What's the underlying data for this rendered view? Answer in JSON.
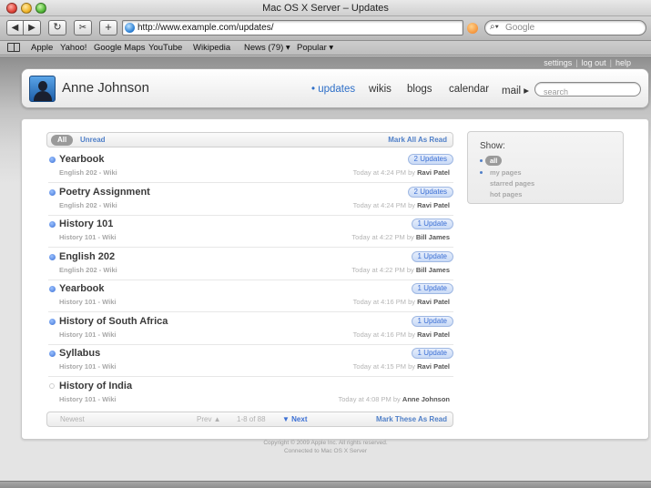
{
  "window": {
    "title": "Mac OS X Server – Updates"
  },
  "browser": {
    "url": "http://www.example.com/updates/",
    "search_placeholder": "Google",
    "bookmarks": [
      "Apple",
      "Yahoo!",
      "Google Maps",
      "YouTube",
      "Wikipedia",
      "News (79) ▾",
      "Popular ▾"
    ]
  },
  "utility_links": {
    "settings": "settings",
    "logout": "log out",
    "help": "help",
    "separator": "|"
  },
  "header": {
    "user_name": "Anne Johnson",
    "nav": {
      "updates": "• updates",
      "wikis": "wikis",
      "blogs": "blogs",
      "calendar": "calendar",
      "mail": "mail ▸"
    },
    "search_placeholder": "search"
  },
  "filter": {
    "all": "All",
    "unread": "Unread",
    "mark_all": "Mark All As Read"
  },
  "updates": [
    {
      "title": "Yearbook",
      "source": "English 202 - Wiki",
      "badge": "2 Updates",
      "time": "Today at 4:24 PM by",
      "author": "Ravi Patel",
      "unread": true
    },
    {
      "title": "Poetry Assignment",
      "source": "English 202 - Wiki",
      "badge": "2 Updates",
      "time": "Today at 4:24 PM by",
      "author": "Ravi Patel",
      "unread": true
    },
    {
      "title": "History 101",
      "source": "History 101 - Wiki",
      "badge": "1 Update",
      "time": "Today at 4:22 PM by",
      "author": "Bill James",
      "unread": true
    },
    {
      "title": "English 202",
      "source": "English 202 - Wiki",
      "badge": "1 Update",
      "time": "Today at 4:22 PM by",
      "author": "Bill James",
      "unread": true
    },
    {
      "title": "Yearbook",
      "source": "History 101 - Wiki",
      "badge": "1 Update",
      "time": "Today at 4:16 PM by",
      "author": "Ravi Patel",
      "unread": true
    },
    {
      "title": "History of South Africa",
      "source": "History 101 - Wiki",
      "badge": "1 Update",
      "time": "Today at 4:16 PM by",
      "author": "Ravi Patel",
      "unread": true
    },
    {
      "title": "Syllabus",
      "source": "History 101 - Wiki",
      "badge": "1 Update",
      "time": "Today at 4:15 PM by",
      "author": "Ravi Patel",
      "unread": true
    },
    {
      "title": "History of India",
      "source": "History 101 - Wiki",
      "badge": "",
      "time": "Today at 4:08 PM by",
      "author": "Anne Johnson",
      "unread": false
    }
  ],
  "pagination": {
    "newest": "Newest",
    "prev": "Prev ▲",
    "range": "1-8 of 88",
    "next": "▼ Next",
    "mark_these": "Mark These As Read"
  },
  "show_panel": {
    "title": "Show:",
    "options": [
      "all",
      "my pages",
      "starred pages",
      "hot pages"
    ]
  },
  "footer": {
    "copyright": "Copyright © 2009 Apple Inc. All rights reserved.",
    "connected": "Connected to Mac OS X Server"
  },
  "colors": {
    "accent": "#3b6fd4",
    "link": "#4f7fc8"
  }
}
